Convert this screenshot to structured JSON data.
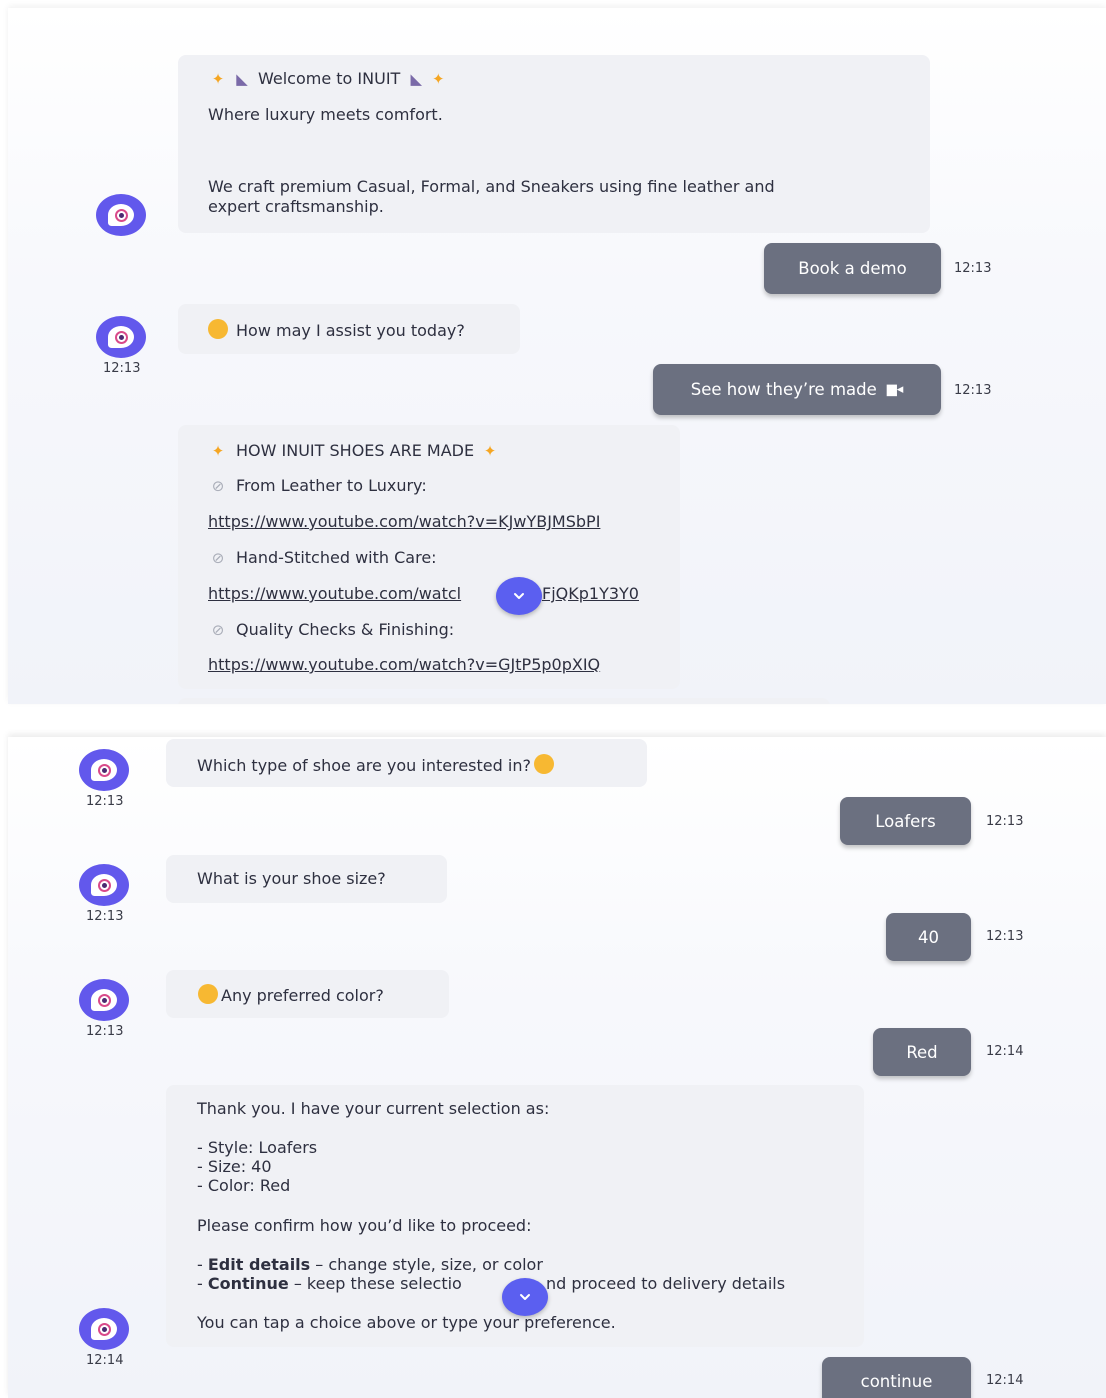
{
  "top_panel": {
    "welcome": {
      "title": "Welcome to INUIT",
      "tagline": "Where luxury meets comfort.",
      "body_line1": "We craft premium Casual, Formal, and Sneakers using fine leather and",
      "body_line2": "expert craftsmanship."
    },
    "user_book_demo": {
      "label": "Book a demo",
      "time": "12:13"
    },
    "assist": {
      "text": "How may I assist you today?",
      "time": "12:13"
    },
    "user_see_how": {
      "label": "See how they’re made",
      "time": "12:13"
    },
    "how_made": {
      "title": "HOW INUIT SHOES ARE MADE",
      "items": [
        {
          "label": "From Leather to Luxury:",
          "url": "https://www.youtube.com/watch?v=KJwYBJMSbPI"
        },
        {
          "label": "Hand-Stitched with Care:",
          "url_left": "https://www.youtube.com/watcl",
          "url_right": "FjQKp1Y3Y0"
        },
        {
          "label": "Quality Checks & Finishing:",
          "url": "https://www.youtube.com/watch?v=GJtP5p0pXIQ"
        }
      ]
    }
  },
  "bottom_panel": {
    "q_type": {
      "text": "Which type of shoe are you interested in?",
      "time": "12:13"
    },
    "a_type": {
      "label": "Loafers",
      "time": "12:13"
    },
    "q_size": {
      "text": "What is your shoe size?",
      "time": "12:13"
    },
    "a_size": {
      "label": "40",
      "time": "12:13"
    },
    "q_color": {
      "text": "Any preferred color?",
      "time": "12:13"
    },
    "a_color": {
      "label": "Red",
      "time": "12:14"
    },
    "summary": {
      "intro": "Thank you. I have your current selection as:",
      "style": "- Style: Loafers",
      "size": "- Size: 40",
      "color": "- Color: Red",
      "confirm": "Please confirm how you’d like to proceed:",
      "edit_bold": "Edit details",
      "edit_rest": " – change style, size, or color",
      "continue_bold": "Continue",
      "continue_rest_left": " – keep these selectio",
      "continue_rest_right": "nd proceed to delivery details",
      "footer": "You can tap a choice above or type your preference.",
      "time": "12:14"
    },
    "a_continue": {
      "label": "continue",
      "time": "12:14"
    }
  },
  "colors": {
    "accent": "#6258ec",
    "user_bubble": "#6b7080",
    "bot_bubble": "#f0f1f5",
    "scroll_button": "#5b5ff0"
  },
  "icons": [
    "sparkle-icon",
    "shoe-icon",
    "link-icon",
    "smile-icon",
    "grin-icon",
    "thinking-icon",
    "camera-icon",
    "chevron-down-icon",
    "bot-avatar-icon"
  ]
}
